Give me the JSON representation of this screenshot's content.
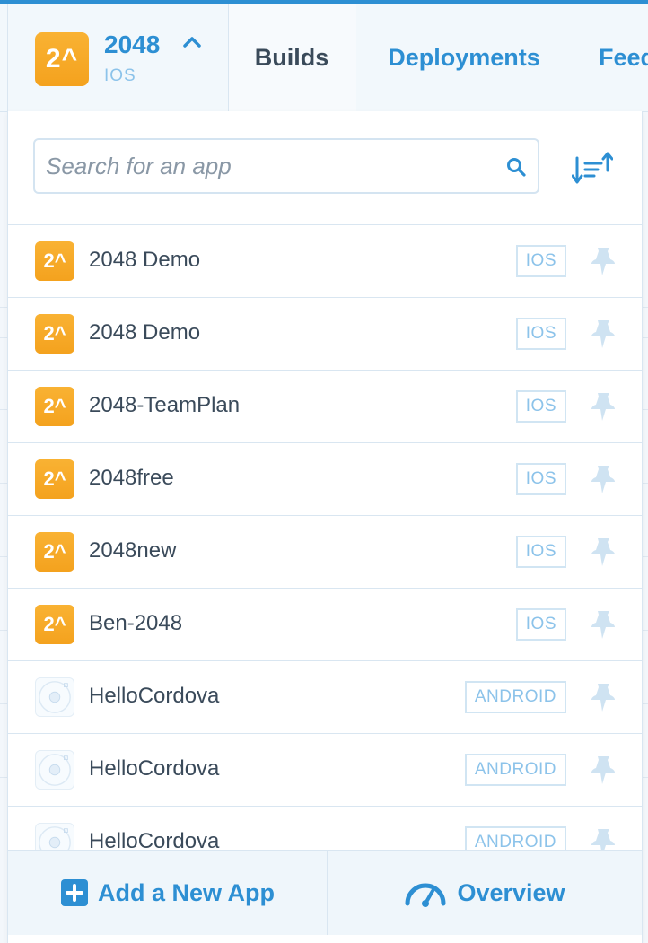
{
  "current_app": {
    "badge": "2^",
    "name": "2048",
    "platform": "IOS"
  },
  "tabs": [
    {
      "label": "Builds"
    },
    {
      "label": "Deployments"
    },
    {
      "label": "Feed"
    }
  ],
  "search": {
    "placeholder": "Search for an app"
  },
  "apps": [
    {
      "name": "2048 Demo",
      "platform": "IOS",
      "icon": "2048-app-icon",
      "badge": "2^"
    },
    {
      "name": "2048 Demo",
      "platform": "IOS",
      "icon": "2048-app-icon",
      "badge": "2^"
    },
    {
      "name": "2048-TeamPlan",
      "platform": "IOS",
      "icon": "2048-app-icon",
      "badge": "2^"
    },
    {
      "name": "2048free",
      "platform": "IOS",
      "icon": "2048-app-icon",
      "badge": "2^"
    },
    {
      "name": "2048new",
      "platform": "IOS",
      "icon": "2048-app-icon",
      "badge": "2^"
    },
    {
      "name": "Ben-2048",
      "platform": "IOS",
      "icon": "2048-app-icon",
      "badge": "2^"
    },
    {
      "name": "HelloCordova",
      "platform": "ANDROID",
      "icon": "cordova-app-icon"
    },
    {
      "name": "HelloCordova",
      "platform": "ANDROID",
      "icon": "cordova-app-icon"
    },
    {
      "name": "HelloCordova",
      "platform": "ANDROID",
      "icon": "cordova-app-icon"
    }
  ],
  "footer": {
    "add_label": "Add a New App",
    "overview_label": "Overview"
  },
  "colors": {
    "accent": "#2d8fd3",
    "ios_icon": "#f4a21e",
    "badge_border": "#d1e5f3"
  }
}
